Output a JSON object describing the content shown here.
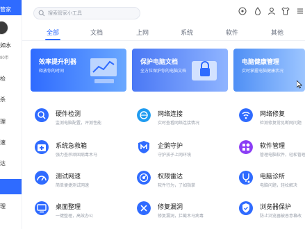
{
  "sidebar": {
    "brand": "管家",
    "username": "如水",
    "points": "90币",
    "items": [
      {
        "label": "检",
        "active": false
      },
      {
        "label": "杀",
        "active": false
      },
      {
        "label": "理",
        "active": false
      },
      {
        "label": "速",
        "active": false
      },
      {
        "label": "达",
        "active": false
      },
      {
        "label": "",
        "active": true
      },
      {
        "label": "理",
        "active": false
      }
    ]
  },
  "search": {
    "placeholder": "搜索管家小工具"
  },
  "tabs": [
    {
      "label": "全部",
      "active": true
    },
    {
      "label": "文档",
      "active": false
    },
    {
      "label": "上网",
      "active": false
    },
    {
      "label": "系统",
      "active": false
    },
    {
      "label": "软件",
      "active": false
    },
    {
      "label": "其他",
      "active": false
    }
  ],
  "banners": [
    {
      "title": "效率提升利器",
      "subtitle": "释放你的时间",
      "color": "#3b82f6"
    },
    {
      "title": "保护电脑文档",
      "subtitle": "全方位保护你的电脑文档",
      "color": "#4f7cf7"
    },
    {
      "title": "电脑健康管理",
      "subtitle": "实时掌握电脑健康状况",
      "color": "#5ea2f5"
    }
  ],
  "tools": [
    {
      "name": "硬件检测",
      "desc": "监测电脑配置，评测性能",
      "icon": "hardware-check-icon",
      "color": "#2f6bff"
    },
    {
      "name": "网络连接",
      "desc": "实时查看网络连接情况",
      "icon": "network-connect-icon",
      "color": "#1e9bf0"
    },
    {
      "name": "网络修复",
      "desc": "检测修复常见断网问题",
      "icon": "network-repair-icon",
      "color": "#2f6bff"
    },
    {
      "name": "系统急救箱",
      "desc": "强力查杀顽固病毒木马",
      "icon": "first-aid-icon",
      "color": "#2f6bff"
    },
    {
      "name": "企鹅守护",
      "desc": "守护孩子上网环境",
      "icon": "penguin-guard-icon",
      "color": "#2f6bff"
    },
    {
      "name": "软件管理",
      "desc": "管理电脑软件，轻松管理",
      "icon": "software-manager-icon",
      "color": "#8b3df5"
    },
    {
      "name": "测试网速",
      "desc": "简单便捷测试网速",
      "icon": "speed-test-icon",
      "color": "#2f6bff"
    },
    {
      "name": "权限雷达",
      "desc": "软件行为，了如指掌",
      "icon": "permission-radar-icon",
      "color": "#2f6bff"
    },
    {
      "name": "电脑诊所",
      "desc": "电脑问题，轻松解决",
      "icon": "pc-clinic-icon",
      "color": "#2f6bff"
    },
    {
      "name": "桌面整理",
      "desc": "一键整理，高效办公",
      "icon": "desktop-organize-icon",
      "color": "#2f6bff"
    },
    {
      "name": "修复漏洞",
      "desc": "修复漏洞，拦截木马病毒",
      "icon": "patch-icon",
      "color": "#2f6bff"
    },
    {
      "name": "浏览器保护",
      "desc": "防止浏览器被恶意篡改",
      "icon": "browser-protect-icon",
      "color": "#2f6bff"
    }
  ]
}
